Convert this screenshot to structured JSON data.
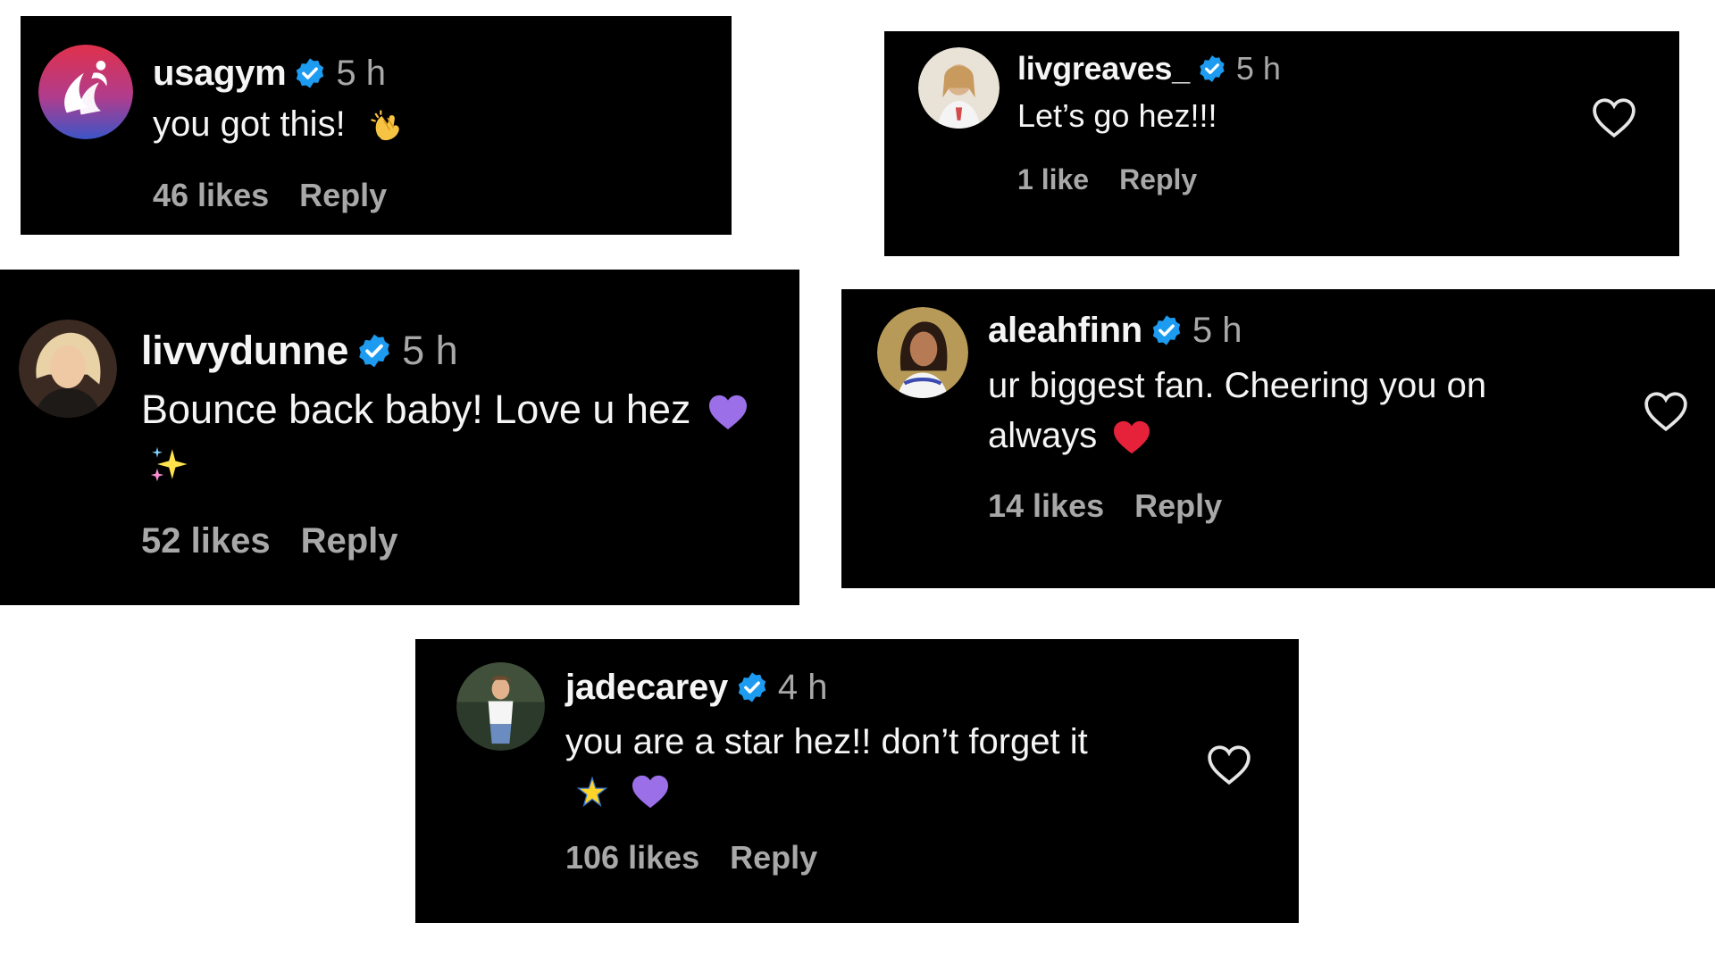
{
  "colors": {
    "card_bg": "#000000",
    "page_bg": "#ffffff",
    "text_primary": "#f5f5f5",
    "text_secondary": "#a8a8a8",
    "verified_blue": "#1d9bf0"
  },
  "comments": [
    {
      "username": "usagym",
      "verified": true,
      "time": "5 h",
      "text": "you got this!",
      "emojis": [
        "clapping-hands"
      ],
      "likes": "46 likes",
      "reply_label": "Reply",
      "has_like_icon": false
    },
    {
      "username": "livgreaves_",
      "verified": true,
      "time": "5 h",
      "text": "Let’s go hez!!!",
      "emojis": [],
      "likes": "1 like",
      "reply_label": "Reply",
      "has_like_icon": true
    },
    {
      "username": "livvydunne",
      "verified": true,
      "time": "5 h",
      "text": "Bounce back baby! Love u hez",
      "emojis": [
        "purple-heart",
        "sparkles"
      ],
      "likes": "52 likes",
      "reply_label": "Reply",
      "has_like_icon": false
    },
    {
      "username": "aleahfinn",
      "verified": true,
      "time": "5 h",
      "text_line1": "ur biggest fan. Cheering you on",
      "text_line2": "always",
      "emojis": [
        "red-heart"
      ],
      "likes": "14 likes",
      "reply_label": "Reply",
      "has_like_icon": true
    },
    {
      "username": "jadecarey",
      "verified": true,
      "time": "4 h",
      "text": "you are a star hez!! don’t forget it",
      "emojis": [
        "star",
        "purple-heart"
      ],
      "likes": "106 likes",
      "reply_label": "Reply",
      "has_like_icon": true
    }
  ]
}
